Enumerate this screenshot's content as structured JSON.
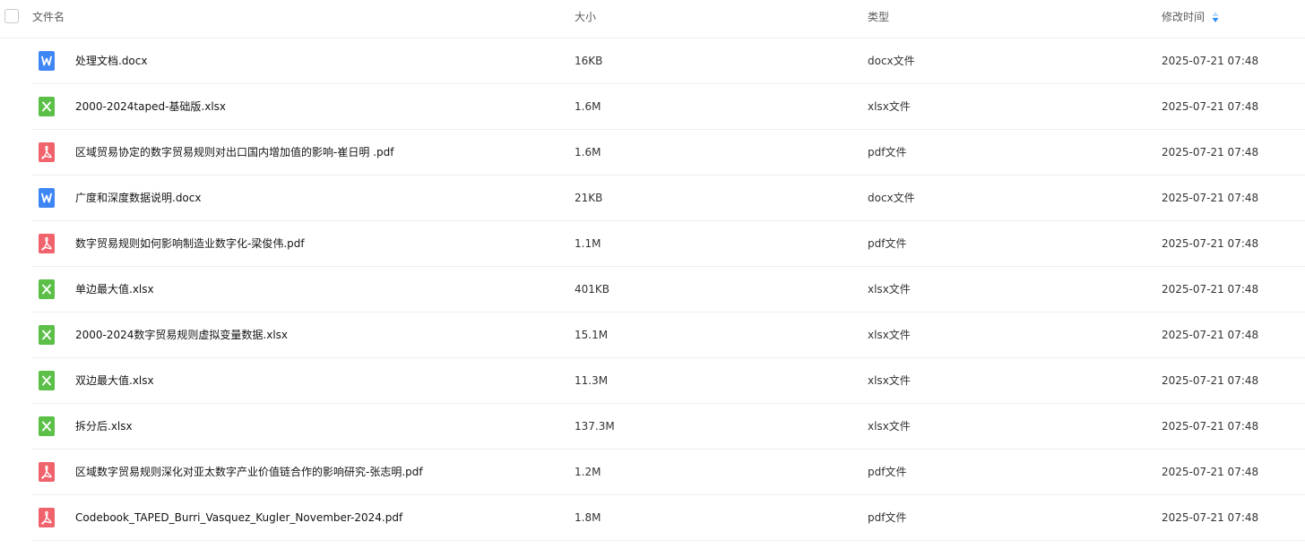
{
  "header": {
    "name": "文件名",
    "size": "大小",
    "type": "类型",
    "modified": "修改时间"
  },
  "colors": {
    "word": "#3f86f5",
    "excel": "#5bbf48",
    "pdf": "#f0636c",
    "sort_active": "#2f8ef5",
    "sort_inactive": "#b9dbfb"
  },
  "files": [
    {
      "icon": "word-icon",
      "name": "处理文档.docx",
      "size": "16KB",
      "type": "docx文件",
      "modified": "2025-07-21 07:48"
    },
    {
      "icon": "excel-icon",
      "name": "2000-2024taped-基础版.xlsx",
      "size": "1.6M",
      "type": "xlsx文件",
      "modified": "2025-07-21 07:48"
    },
    {
      "icon": "pdf-icon",
      "name": "区域贸易协定的数字贸易规则对出口国内增加值的影响-崔日明 .pdf",
      "size": "1.6M",
      "type": "pdf文件",
      "modified": "2025-07-21 07:48"
    },
    {
      "icon": "word-icon",
      "name": "广度和深度数据说明.docx",
      "size": "21KB",
      "type": "docx文件",
      "modified": "2025-07-21 07:48"
    },
    {
      "icon": "pdf-icon",
      "name": "数字贸易规则如何影响制造业数字化-梁俊伟.pdf",
      "size": "1.1M",
      "type": "pdf文件",
      "modified": "2025-07-21 07:48"
    },
    {
      "icon": "excel-icon",
      "name": "单边最大值.xlsx",
      "size": "401KB",
      "type": "xlsx文件",
      "modified": "2025-07-21 07:48"
    },
    {
      "icon": "excel-icon",
      "name": "2000-2024数字贸易规则虚拟变量数据.xlsx",
      "size": "15.1M",
      "type": "xlsx文件",
      "modified": "2025-07-21 07:48"
    },
    {
      "icon": "excel-icon",
      "name": "双边最大值.xlsx",
      "size": "11.3M",
      "type": "xlsx文件",
      "modified": "2025-07-21 07:48"
    },
    {
      "icon": "excel-icon",
      "name": "拆分后.xlsx",
      "size": "137.3M",
      "type": "xlsx文件",
      "modified": "2025-07-21 07:48"
    },
    {
      "icon": "pdf-icon",
      "name": "区域数字贸易规则深化对亚太数字产业价值链合作的影响研究-张志明.pdf",
      "size": "1.2M",
      "type": "pdf文件",
      "modified": "2025-07-21 07:48"
    },
    {
      "icon": "pdf-icon",
      "name": "Codebook_TAPED_Burri_Vasquez_Kugler_November-2024.pdf",
      "size": "1.8M",
      "type": "pdf文件",
      "modified": "2025-07-21 07:48"
    }
  ]
}
